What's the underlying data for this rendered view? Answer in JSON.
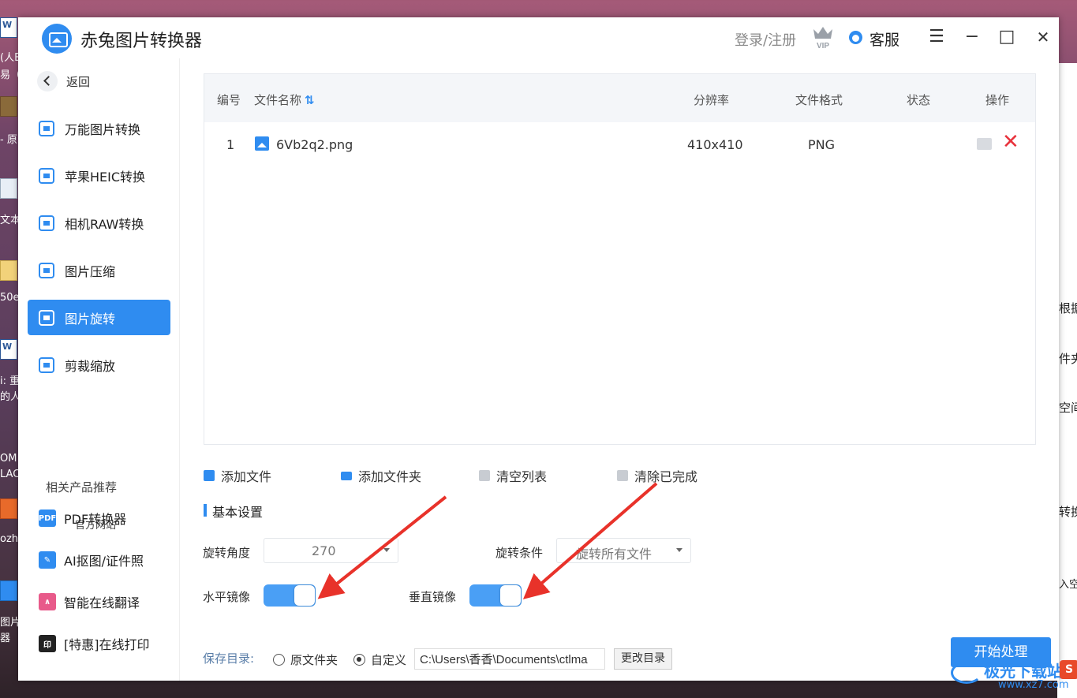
{
  "app": {
    "title": "赤兔图片转换器",
    "login_label": "登录/注册",
    "vip_label": "VIP",
    "service_label": "客服",
    "menu_glyph": "☰",
    "minimize_glyph": "−",
    "maximize_glyph": "□",
    "close_glyph": "✕"
  },
  "sidebar": {
    "back_label": "返回",
    "items": [
      {
        "label": "万能图片转换",
        "icon": "image-convert-icon",
        "active": false
      },
      {
        "label": "苹果HEIC转换",
        "icon": "heic-icon",
        "active": false
      },
      {
        "label": "相机RAW转换",
        "icon": "raw-icon",
        "active": false
      },
      {
        "label": "图片压缩",
        "icon": "compress-icon",
        "active": false
      },
      {
        "label": "图片旋转",
        "icon": "rotate-icon",
        "active": true
      },
      {
        "label": "剪裁缩放",
        "icon": "crop-icon",
        "active": false
      }
    ],
    "recommend_title": "相关产品推荐",
    "official_site": "官方网站",
    "recommend": [
      {
        "label": "PDF转换器",
        "icon": "pdf-icon",
        "glyph": "PDF",
        "color": "#2f8cf0"
      },
      {
        "label": "AI抠图/证件照",
        "icon": "ai-cutout-icon",
        "glyph": "✎",
        "color": "#2f8cf0"
      },
      {
        "label": "智能在线翻译",
        "icon": "translate-icon",
        "glyph": "∧",
        "color": "#e85a8a"
      },
      {
        "label": "[特惠]在线打印",
        "icon": "print-icon",
        "glyph": "印",
        "color": "#222222"
      }
    ]
  },
  "table": {
    "headers": {
      "num": "编号",
      "name": "文件名称",
      "sort_glyph": "⇅",
      "resolution": "分辨率",
      "format": "文件格式",
      "status": "状态",
      "ops": "操作"
    },
    "rows": [
      {
        "num": "1",
        "name": "6Vb2q2.png",
        "resolution": "410x410",
        "format": "PNG",
        "status": ""
      }
    ],
    "delete_glyph": "✕"
  },
  "toolbar": {
    "add_file": "添加文件",
    "add_folder": "添加文件夹",
    "clear_list": "清空列表",
    "clear_done": "清除已完成"
  },
  "settings": {
    "title": "基本设置",
    "angle_label": "旋转角度",
    "angle_value": "270",
    "condition_label": "旋转条件",
    "condition_value": "旋转所有文件",
    "h_mirror_label": "水平镜像",
    "h_mirror_on": true,
    "v_mirror_label": "垂直镜像",
    "v_mirror_on": true
  },
  "save": {
    "label": "保存目录:",
    "option_original": "原文件夹",
    "option_custom": "自定义",
    "selected": "custom",
    "path": "C:\\Users\\香香\\Documents\\ctlma",
    "change_button": "更改目录",
    "start_button": "开始处理"
  },
  "watermark": {
    "text": "极光下载站",
    "url": "www.xz7.com",
    "badge": "S"
  },
  "desktop": {
    "left_texts": [
      "(人B",
      "易（",
      "- 原",
      "文本",
      "50e",
      "i: 重",
      "的人",
      "OM",
      "LAC",
      "ozho",
      "图片",
      "器"
    ],
    "right_texts": [
      "根据",
      "件夹",
      "空间",
      "转换",
      "入空"
    ]
  },
  "colors": {
    "accent": "#2f8cf0",
    "delete": "#e8323c",
    "toggle": "#4a9ff5",
    "arrow": "#e8322a"
  }
}
